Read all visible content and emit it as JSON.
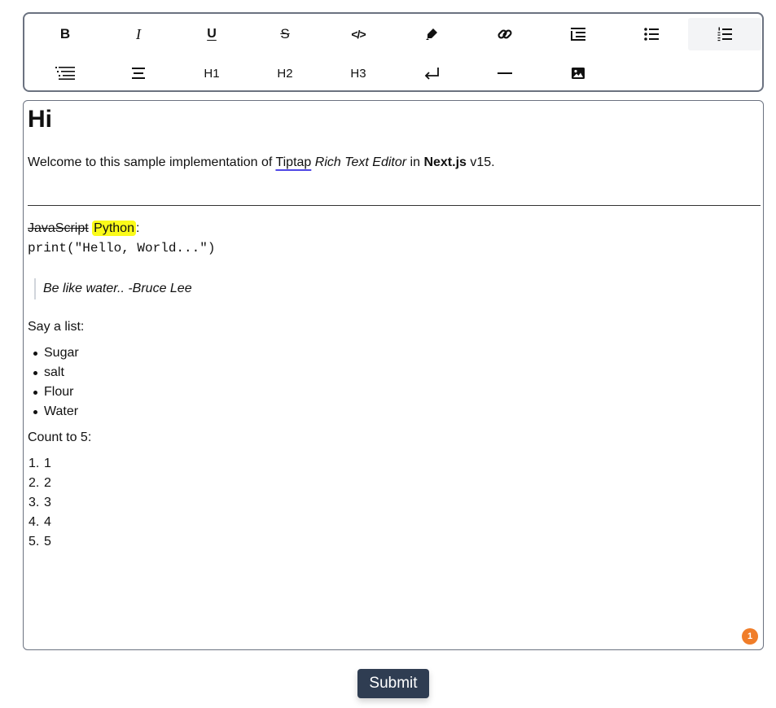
{
  "toolbar": {
    "row1": [
      {
        "name": "bold-button",
        "icon": "bold-icon",
        "text": "B"
      },
      {
        "name": "italic-button",
        "icon": "italic-icon",
        "text": "I"
      },
      {
        "name": "underline-button",
        "icon": "underline-icon",
        "text": "U"
      },
      {
        "name": "strikethrough-button",
        "icon": "strikethrough-icon",
        "text": "S"
      },
      {
        "name": "code-button",
        "icon": "code-icon",
        "text": "</>"
      },
      {
        "name": "highlight-button",
        "icon": "highlighter-icon"
      },
      {
        "name": "link-button",
        "icon": "link-icon"
      },
      {
        "name": "code-block-button",
        "icon": "indent-list-icon"
      },
      {
        "name": "bullet-list-button",
        "icon": "bullet-list-icon"
      },
      {
        "name": "ordered-list-button",
        "icon": "ordered-list-icon",
        "active": true
      }
    ],
    "row2": [
      {
        "name": "blockquote-button",
        "icon": "text-indent-icon"
      },
      {
        "name": "align-center-button",
        "icon": "align-center-icon"
      },
      {
        "name": "heading1-button",
        "text": "H1"
      },
      {
        "name": "heading2-button",
        "text": "H2"
      },
      {
        "name": "heading3-button",
        "text": "H3"
      },
      {
        "name": "hard-break-button",
        "icon": "enter-icon"
      },
      {
        "name": "horizontal-rule-button",
        "icon": "minus-icon"
      },
      {
        "name": "image-button",
        "icon": "image-icon"
      }
    ]
  },
  "editor": {
    "heading": "Hi",
    "intro": {
      "before": "Welcome to this sample implementation of ",
      "link": "Tiptap",
      "italic": " Rich Text Editor",
      "mid": " in ",
      "bold": "Next.js",
      "after": " v15."
    },
    "lang": {
      "struck": "JavaScript",
      "highlighted": "Python",
      "suffix": ":"
    },
    "code": "print(\"Hello, World...\")",
    "quote": "Be like water.. -Bruce Lee",
    "list_intro": "Say a list:",
    "bullets": [
      "Sugar",
      "salt",
      "Flour",
      "Water"
    ],
    "count_intro": "Count to 5:",
    "numbers": [
      "1",
      "2",
      "3",
      "4",
      "5"
    ],
    "badge": "1"
  },
  "colors": {
    "highlight": "#fbfb1a",
    "link_underline": "#4f46e5",
    "badge": "#f07d29",
    "submit_bg": "#2f3d52"
  },
  "submit_label": "Submit"
}
